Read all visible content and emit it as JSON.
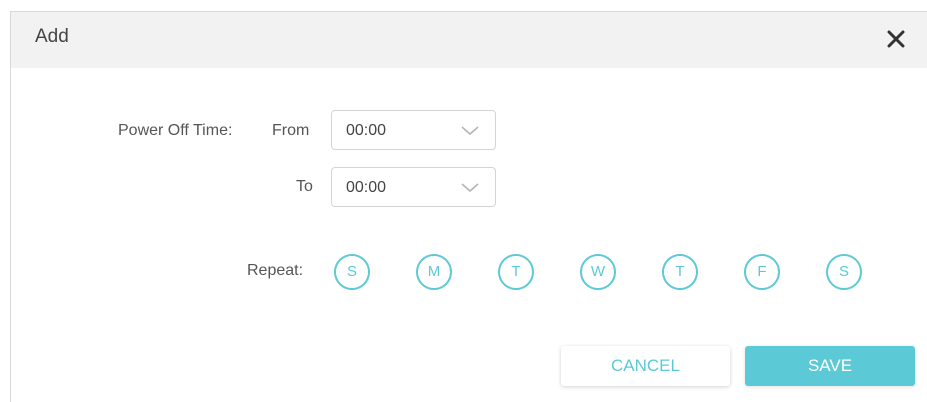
{
  "dialog": {
    "title": "Add",
    "close_icon": "close-icon"
  },
  "power_off": {
    "label": "Power Off Time:",
    "from_label": "From",
    "from_value": "00:00",
    "to_label": "To",
    "to_value": "00:00"
  },
  "repeat": {
    "label": "Repeat:",
    "days": [
      "S",
      "M",
      "T",
      "W",
      "T",
      "F",
      "S"
    ]
  },
  "buttons": {
    "cancel": "CANCEL",
    "save": "SAVE"
  },
  "colors": {
    "accent": "#5cc9d6",
    "header_bg": "#f2f2f2"
  }
}
